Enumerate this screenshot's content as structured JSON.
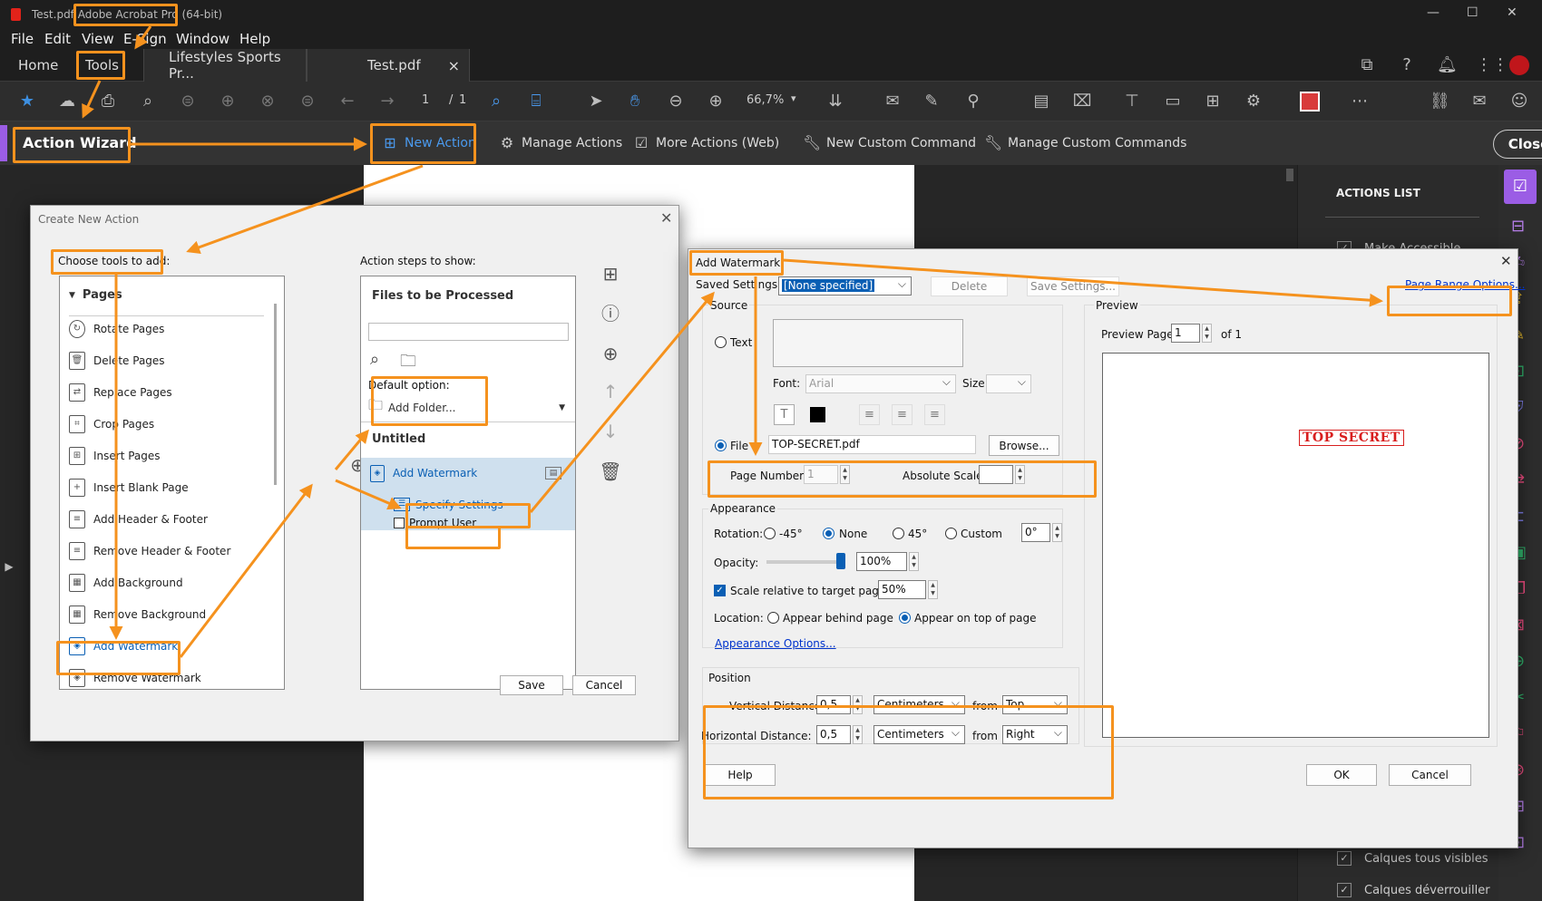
{
  "window": {
    "doc_title": "Test.pdf",
    "app_name": "Adobe Acrobat Pro",
    "arch": "(64-bit)",
    "min": "—",
    "max": "☐",
    "close": "✕"
  },
  "menu": [
    "File",
    "Edit",
    "View",
    "E-Sign",
    "Window",
    "Help"
  ],
  "tabs": {
    "home": "Home",
    "tools": "Tools",
    "doc1": "Lifestyles Sports Pr...",
    "doc2": "Test.pdf",
    "doc2_close": "×"
  },
  "toolbar": {
    "page_current": "1",
    "page_sep": "/",
    "page_total": "1",
    "zoom": "66,7%"
  },
  "action_bar": {
    "title": "Action Wizard",
    "new_action": "New Action",
    "manage_actions": "Manage Actions",
    "more_actions": "More Actions (Web)",
    "new_custom": "New Custom Command",
    "manage_custom": "Manage Custom Commands",
    "close": "Close"
  },
  "right_panel": {
    "header": "ACTIONS LIST",
    "items": [
      "Make Accessible",
      "Calques tous visibles",
      "Calques déverrouiller"
    ]
  },
  "create_action": {
    "title": "Create New Action",
    "choose_label": "Choose tools to add:",
    "category": "Pages",
    "tools": [
      "Rotate Pages",
      "Delete Pages",
      "Replace Pages",
      "Crop Pages",
      "Insert Pages",
      "Insert Blank Page",
      "Add Header & Footer",
      "Remove Header & Footer",
      "Add Background",
      "Remove Background",
      "Add Watermark",
      "Remove Watermark"
    ],
    "steps_label": "Action steps to show:",
    "files_header": "Files to be Processed",
    "default_option": "Default option:",
    "add_folder": "Add Folder...",
    "untitled": "Untitled",
    "step_name": "Add Watermark",
    "specify_settings": "Specify Settings",
    "prompt_user": "Prompt User",
    "save": "Save",
    "cancel": "Cancel"
  },
  "watermark": {
    "title": "Add Watermark",
    "saved_settings_label": "Saved Settings:",
    "saved_settings_value": "[None specified]",
    "delete": "Delete",
    "save_settings": "Save Settings...",
    "page_range": "Page Range Options...",
    "source": "Source",
    "text": "Text",
    "font_label": "Font:",
    "font_value": "Arial",
    "size_label": "Size:",
    "file": "File",
    "file_value": "TOP-SECRET.pdf",
    "browse": "Browse...",
    "page_number_label": "Page Number:",
    "page_number_value": "1",
    "absolute_scale": "Absolute Scale:",
    "appearance": "Appearance",
    "rotation_label": "Rotation:",
    "rot_neg45": "-45°",
    "rot_none": "None",
    "rot_45": "45°",
    "rot_custom": "Custom",
    "rot_custom_value": "0°",
    "opacity_label": "Opacity:",
    "opacity_value": "100%",
    "opacity_fraction": 1.0,
    "scale_label": "Scale relative to target page",
    "scale_value": "50%",
    "location_label": "Location:",
    "behind": "Appear behind page",
    "ontop": "Appear on top of page",
    "appearance_options": "Appearance Options...",
    "position": "Position",
    "vertical_label": "Vertical Distance:",
    "vertical_value": "0,5",
    "horizontal_label": "Horizontal Distance:",
    "horizontal_value": "0,5",
    "unit": "Centimeters",
    "from": "from",
    "from_top": "Top",
    "from_right": "Right",
    "preview": "Preview",
    "preview_page_label": "Preview Page",
    "preview_page_value": "1",
    "preview_of": "of 1",
    "preview_stamp": "TOP SECRET",
    "help": "Help",
    "ok": "OK",
    "cancel": "Cancel"
  },
  "colors": {
    "accent_orange": "#f5921e",
    "acrobat_red": "#e2231a",
    "link_blue": "#0033cc",
    "select_blue": "#0a5fb4",
    "strip_purple": "#9b5de5"
  }
}
